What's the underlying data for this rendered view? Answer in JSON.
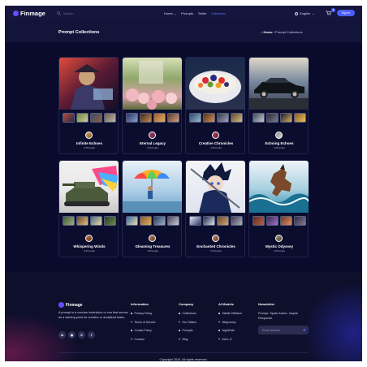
{
  "header": {
    "brand": "Finmage",
    "search_placeholder": "Search",
    "nav": [
      {
        "label": "Home"
      },
      {
        "label": "Prompts"
      },
      {
        "label": "Seller"
      },
      {
        "label": "Collection"
      }
    ],
    "language": "English",
    "cart_count": "1",
    "signin_label": "Sign in"
  },
  "title_bar": {
    "title": "Prompt Collections",
    "breadcrumb_home": "Home",
    "breadcrumb_separator": "/",
    "breadcrumb_current": "Prompt Collections"
  },
  "collections": [
    {
      "title": "Infinite Echoes",
      "count": "4 Prompts"
    },
    {
      "title": "Eternal Legacy",
      "count": "4 Prompts"
    },
    {
      "title": "Creative Chronicles",
      "count": "4 Prompts"
    },
    {
      "title": "Echoing Echoes",
      "count": "4 Prompts"
    },
    {
      "title": "Whispering Winds",
      "count": "4 Prompts"
    },
    {
      "title": "Gleaming Treasures",
      "count": "4 Prompts"
    },
    {
      "title": "Enchanted Chronicles",
      "count": "5 Prompts"
    },
    {
      "title": "Mystic Odyssey",
      "count": "4 Prompts"
    }
  ],
  "footer": {
    "brand": "Finmage",
    "description": "A prompt is a concise instruction or cue that serves as a starting point for creative or analytical tasks.",
    "socials": [
      "in",
      "◉",
      "X",
      "f"
    ],
    "columns": [
      {
        "heading": "Information",
        "links": [
          "Privacy Policy",
          "Terms of Service",
          "Cookie Policy",
          "Contact"
        ]
      },
      {
        "heading": "Company",
        "links": [
          "Collections",
          "Our Sellers",
          "Prompts",
          "Blog"
        ]
      },
      {
        "heading": "AI Models",
        "links": [
          "Stable Diffusion",
          "Midjourney",
          "NightCafe",
          "DALL-E"
        ]
      }
    ],
    "newsletter": {
      "heading": "Newsletter",
      "text": "Prompt. Spark Action. Inspire Response.",
      "email_placeholder": "Email address"
    },
    "copyright": "Copyright 2024. All rights reserved."
  },
  "colors": {
    "background": "#0a0a2c",
    "header": "#15153d",
    "accent": "#4d5dff",
    "card_border": "#22244c"
  }
}
